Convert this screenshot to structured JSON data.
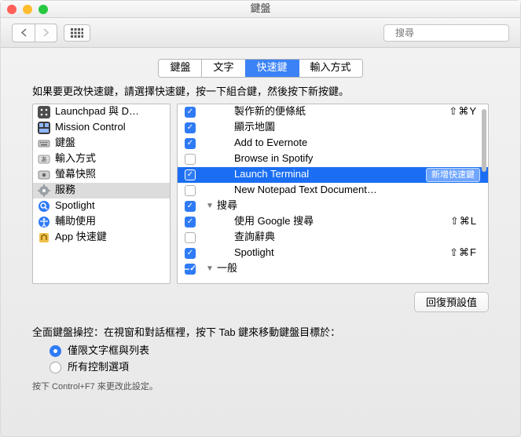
{
  "window": {
    "title": "鍵盤"
  },
  "toolbar": {
    "search_placeholder": "搜尋"
  },
  "tabs": [
    "鍵盤",
    "文字",
    "快速鍵",
    "輸入方式"
  ],
  "active_tab_index": 2,
  "instruction": "如果要更改快速鍵，請選擇快速鍵，按一下組合鍵，然後按下新按鍵。",
  "categories": [
    {
      "icon": "launchpad-icon",
      "label": "Launchpad 與 D…"
    },
    {
      "icon": "mission-control-icon",
      "label": "Mission Control"
    },
    {
      "icon": "keyboard-icon",
      "label": "鍵盤"
    },
    {
      "icon": "input-icon",
      "label": "輸入方式"
    },
    {
      "icon": "screenshot-icon",
      "label": "螢幕快照"
    },
    {
      "icon": "services-icon",
      "label": "服務"
    },
    {
      "icon": "spotlight-icon",
      "label": "Spotlight"
    },
    {
      "icon": "accessibility-icon",
      "label": "輔助使用"
    },
    {
      "icon": "app-shortcuts-icon",
      "label": "App 快速鍵"
    }
  ],
  "selected_category_index": 5,
  "rows": [
    {
      "depth": 1,
      "checked": true,
      "label": "製作新的便條紙",
      "shortcut": "⇧⌘Y"
    },
    {
      "depth": 1,
      "checked": true,
      "label": "顯示地圖",
      "shortcut": ""
    },
    {
      "depth": 1,
      "checked": true,
      "label": "Add to Evernote",
      "shortcut": ""
    },
    {
      "depth": 1,
      "checked": false,
      "label": "Browse in Spotify",
      "shortcut": ""
    },
    {
      "depth": 1,
      "checked": true,
      "label": "Launch Terminal",
      "shortcut": "",
      "selected": true,
      "badge": "新增快速鍵"
    },
    {
      "depth": 1,
      "checked": false,
      "label": "New Notepad Text Document…",
      "shortcut": ""
    },
    {
      "depth": 0,
      "checked": true,
      "group": true,
      "label": "搜尋"
    },
    {
      "depth": 1,
      "checked": true,
      "label": "使用 Google 搜尋",
      "shortcut": "⇧⌘L"
    },
    {
      "depth": 1,
      "checked": false,
      "label": "查詢辭典",
      "shortcut": ""
    },
    {
      "depth": 1,
      "checked": true,
      "label": "Spotlight",
      "shortcut": "⇧⌘F"
    },
    {
      "depth": 0,
      "checked": true,
      "mixed": true,
      "group": true,
      "label": "一般"
    }
  ],
  "restore_button": "回復預設值",
  "fka_label": "全面鍵盤操控：在視窗和對話框裡，按下 Tab 鍵來移動鍵盤目標於：",
  "fka_options": [
    "僅限文字框與列表",
    "所有控制選項"
  ],
  "fka_selected_index": 0,
  "hint": "按下 Control+F7 來更改此設定。"
}
